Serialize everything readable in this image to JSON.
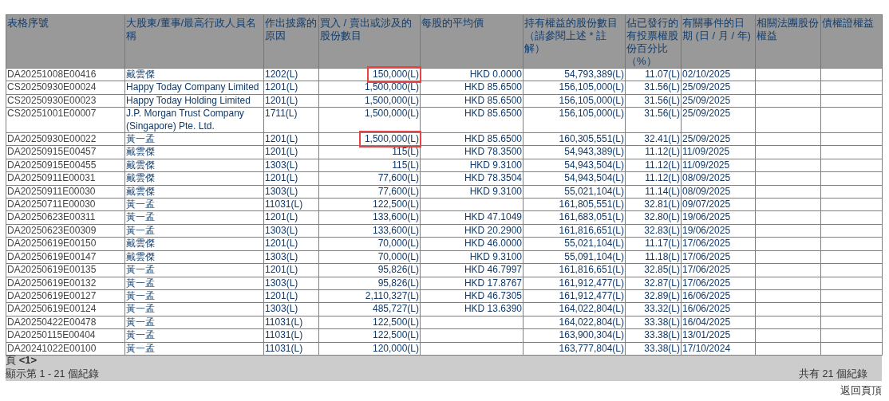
{
  "table": {
    "columns": [
      "表格序號",
      "大股東/董事/最高行政人員名稱",
      "作出披露的原因",
      "買入 / 賣出或涉及的股份數目",
      "每股的平均價",
      "持有權益的股份數目（請參閱上述 * 註解）",
      "佔已發行的有投票權股份百分比（%）",
      "有關事件的日期 (日 / 月 / 年)",
      "相關法團股份權益",
      "債權證權益"
    ],
    "rows": [
      {
        "id": "DA20251008E00416",
        "name": "戴雲傑",
        "reason": "1202(L)",
        "shares": "150,000(L)",
        "highlighted": true,
        "price": "HKD 0.0000",
        "holding": "54,793,389(L)",
        "percent": "11.07(L)",
        "date": "02/10/2025"
      },
      {
        "id": "CS20250930E00024",
        "name": "Happy Today Company Limited",
        "reason": "1201(L)",
        "shares": "1,500,000(L)",
        "highlighted": false,
        "price": "HKD 85.6500",
        "holding": "156,105,000(L)",
        "percent": "31.56(L)",
        "date": "25/09/2025"
      },
      {
        "id": "CS20250930E00023",
        "name": "Happy Today Holding Limited",
        "reason": "1201(L)",
        "shares": "1,500,000(L)",
        "highlighted": false,
        "price": "HKD 85.6500",
        "holding": "156,105,000(L)",
        "percent": "31.56(L)",
        "date": "25/09/2025"
      },
      {
        "id": "CS20251001E00007",
        "name": "J.P. Morgan Trust Company (Singapore) Pte. Ltd.",
        "reason": "1711(L)",
        "shares": "1,500,000(L)",
        "highlighted": false,
        "price": "HKD 85.6500",
        "holding": "156,105,000(L)",
        "percent": "31.56(L)",
        "date": "25/09/2025"
      },
      {
        "id": "DA20250930E00022",
        "name": "黃一孟",
        "reason": "1201(L)",
        "shares": "1,500,000(L)",
        "highlighted": true,
        "price": "HKD 85.6500",
        "holding": "160,305,551(L)",
        "percent": "32.41(L)",
        "date": "25/09/2025"
      },
      {
        "id": "DA20250915E00457",
        "name": "戴雲傑",
        "reason": "1201(L)",
        "shares": "115(L)",
        "highlighted": false,
        "price": "HKD 78.3500",
        "holding": "54,943,389(L)",
        "percent": "11.12(L)",
        "date": "11/09/2025"
      },
      {
        "id": "DA20250915E00455",
        "name": "戴雲傑",
        "reason": "1303(L)",
        "shares": "115(L)",
        "highlighted": false,
        "price": "HKD 9.3100",
        "holding": "54,943,504(L)",
        "percent": "11.12(L)",
        "date": "11/09/2025"
      },
      {
        "id": "DA20250911E00031",
        "name": "戴雲傑",
        "reason": "1201(L)",
        "shares": "77,600(L)",
        "highlighted": false,
        "price": "HKD 78.3504",
        "holding": "54,943,504(L)",
        "percent": "11.12(L)",
        "date": "08/09/2025"
      },
      {
        "id": "DA20250911E00030",
        "name": "戴雲傑",
        "reason": "1303(L)",
        "shares": "77,600(L)",
        "highlighted": false,
        "price": "HKD 9.3100",
        "holding": "55,021,104(L)",
        "percent": "11.14(L)",
        "date": "08/09/2025"
      },
      {
        "id": "DA20250711E00030",
        "name": "黃一孟",
        "reason": "11031(L)",
        "shares": "122,500(L)",
        "highlighted": false,
        "holding": "161,805,551(L)",
        "percent": "32.81(L)",
        "date": "09/07/2025"
      },
      {
        "id": "DA20250623E00311",
        "name": "黃一孟",
        "reason": "1201(L)",
        "shares": "133,600(L)",
        "highlighted": false,
        "price": "HKD 47.1049",
        "holding": "161,683,051(L)",
        "percent": "32.80(L)",
        "date": "19/06/2025"
      },
      {
        "id": "DA20250623E00309",
        "name": "黃一孟",
        "reason": "1303(L)",
        "shares": "133,600(L)",
        "highlighted": false,
        "price": "HKD 20.2900",
        "holding": "161,816,651(L)",
        "percent": "32.83(L)",
        "date": "19/06/2025"
      },
      {
        "id": "DA20250619E00150",
        "name": "戴雲傑",
        "reason": "1201(L)",
        "shares": "70,000(L)",
        "highlighted": false,
        "price": "HKD 46.0000",
        "holding": "55,021,104(L)",
        "percent": "11.17(L)",
        "date": "17/06/2025"
      },
      {
        "id": "DA20250619E00147",
        "name": "戴雲傑",
        "reason": "1303(L)",
        "shares": "70,000(L)",
        "highlighted": false,
        "price": "HKD 9.3100",
        "holding": "55,091,104(L)",
        "percent": "11.18(L)",
        "date": "17/06/2025"
      },
      {
        "id": "DA20250619E00135",
        "name": "黃一孟",
        "reason": "1201(L)",
        "shares": "95,826(L)",
        "highlighted": false,
        "price": "HKD 46.7997",
        "holding": "161,816,651(L)",
        "percent": "32.85(L)",
        "date": "17/06/2025"
      },
      {
        "id": "DA20250619E00132",
        "name": "黃一孟",
        "reason": "1303(L)",
        "shares": "95,826(L)",
        "highlighted": false,
        "price": "HKD 17.8767",
        "holding": "161,912,477(L)",
        "percent": "32.87(L)",
        "date": "17/06/2025"
      },
      {
        "id": "DA20250619E00127",
        "name": "黃一孟",
        "reason": "1201(L)",
        "shares": "2,110,327(L)",
        "highlighted": false,
        "price": "HKD 46.7305",
        "holding": "161,912,477(L)",
        "percent": "32.89(L)",
        "date": "16/06/2025"
      },
      {
        "id": "DA20250619E00124",
        "name": "黃一孟",
        "reason": "1303(L)",
        "shares": "485,727(L)",
        "highlighted": false,
        "price": "HKD 13.6390",
        "holding": "164,022,804(L)",
        "percent": "33.32(L)",
        "date": "16/06/2025"
      },
      {
        "id": "DA20250422E00478",
        "name": "黃一孟",
        "reason": "11031(L)",
        "shares": "122,500(L)",
        "highlighted": false,
        "holding": "164,022,804(L)",
        "percent": "33.38(L)",
        "date": "16/04/2025"
      },
      {
        "id": "DA20250115E00404",
        "name": "黃一孟",
        "reason": "11031(L)",
        "shares": "122,500(L)",
        "highlighted": false,
        "holding": "163,900,304(L)",
        "percent": "33.38(L)",
        "date": "13/01/2025"
      },
      {
        "id": "DA20241022E00100",
        "name": "黃一孟",
        "reason": "11031(L)",
        "shares": "120,000(L)",
        "highlighted": false,
        "holding": "163,777,804(L)",
        "percent": "33.38(L)",
        "date": "17/10/2024"
      }
    ]
  },
  "footer": {
    "pager": "頁 **<1>**",
    "showing": "顯示第 1 - 21 個紀錄",
    "total": "共有 21 個紀錄"
  },
  "back_to_top": "返回頁頂"
}
